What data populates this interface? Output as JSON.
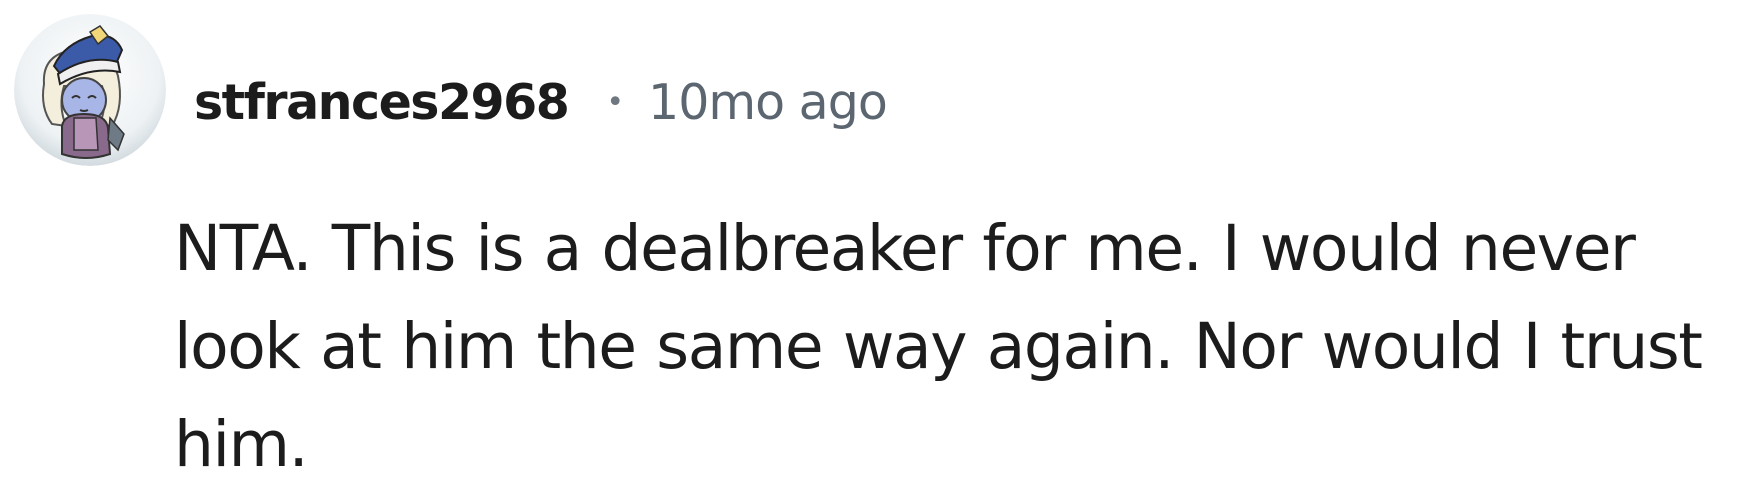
{
  "comment": {
    "author": "stfrances2968",
    "separator": "•",
    "timestamp": "10mo ago",
    "avatar_icon": "avatar-icon",
    "body_lines": [
      "NTA. This is a dealbreaker for me. I would never",
      "look at him the same way again. Nor would I trust",
      "him."
    ]
  },
  "colors": {
    "author": "#1c1c1c",
    "timestamp": "#5c6670",
    "body": "#1c1c1c",
    "background": "#ffffff"
  }
}
